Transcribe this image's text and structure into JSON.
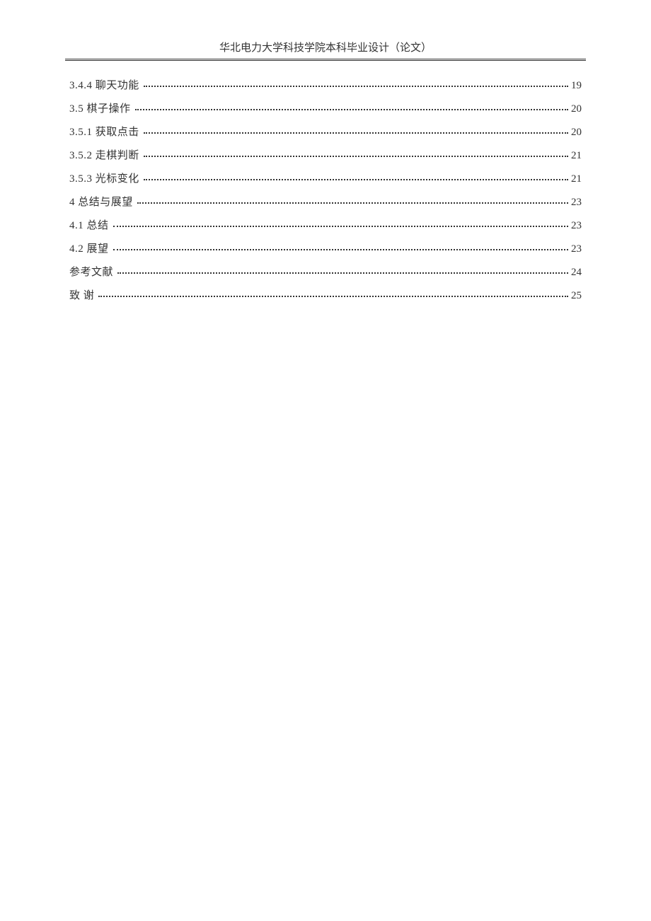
{
  "header": {
    "title": "华北电力大学科技学院本科毕业设计（论文）"
  },
  "toc": {
    "entries": [
      {
        "label": "3.4.4 聊天功能",
        "page": "19"
      },
      {
        "label": "3.5 棋子操作",
        "page": "20"
      },
      {
        "label": "3.5.1 获取点击",
        "page": "20"
      },
      {
        "label": "3.5.2 走棋判断",
        "page": "21"
      },
      {
        "label": "3.5.3 光标变化",
        "page": "21"
      },
      {
        "label": "4 总结与展望",
        "page": "23"
      },
      {
        "label": "4.1 总结",
        "page": "23"
      },
      {
        "label": "4.2 展望",
        "page": "23"
      },
      {
        "label": "参考文献",
        "page": "24"
      },
      {
        "label": "致  谢",
        "page": "25"
      }
    ]
  }
}
